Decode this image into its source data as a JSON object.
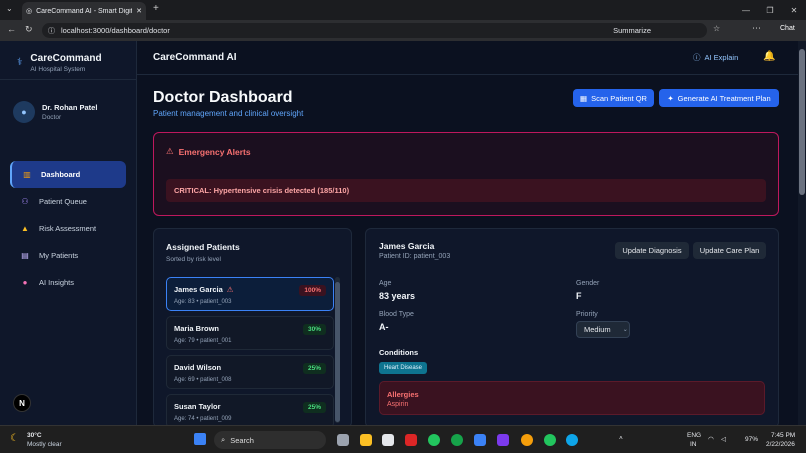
{
  "browser": {
    "tab_title": "CareCommand AI - Smart Digital H",
    "url": "localhost:3000/dashboard/doctor",
    "summarize_label": "Summarize",
    "chat_label": "Chat"
  },
  "sidebar": {
    "brand_title": "CareCommand",
    "brand_subtitle": "AI Hospital System",
    "user_name": "Dr. Rohan Patel",
    "user_role": "Doctor",
    "items": [
      {
        "label": "Dashboard",
        "icon": "chart-icon"
      },
      {
        "label": "Patient Queue",
        "icon": "users-icon"
      },
      {
        "label": "Risk Assessment",
        "icon": "warning-icon"
      },
      {
        "label": "My Patients",
        "icon": "clipboard-icon"
      },
      {
        "label": "AI Insights",
        "icon": "brain-icon"
      }
    ],
    "badge": "N"
  },
  "header": {
    "app_title": "CareCommand AI",
    "ai_explain": "AI Explain"
  },
  "page": {
    "title": "Doctor Dashboard",
    "subtitle": "Patient management and clinical oversight",
    "scan_button": "Scan Patient QR",
    "generate_button": "Generate AI Treatment Plan"
  },
  "alerts": {
    "title": "Emergency Alerts",
    "items": [
      "CRITICAL: Hypertensive crisis detected (185/110)"
    ]
  },
  "assigned": {
    "title": "Assigned Patients",
    "subtitle": "Sorted by risk level",
    "patients": [
      {
        "name": "James Garcia",
        "meta": "Age: 83 • patient_003",
        "risk": "100%"
      },
      {
        "name": "Maria Brown",
        "meta": "Age: 79 • patient_001",
        "risk": "30%"
      },
      {
        "name": "David Wilson",
        "meta": "Age: 69 • patient_008",
        "risk": "25%"
      },
      {
        "name": "Susan Taylor",
        "meta": "Age: 74 • patient_009",
        "risk": "25%"
      }
    ]
  },
  "detail": {
    "name": "James Garcia",
    "patient_id": "Patient ID: patient_003",
    "update_diagnosis": "Update Diagnosis",
    "update_care_plan": "Update Care Plan",
    "age_label": "Age",
    "age_value": "83 years",
    "gender_label": "Gender",
    "gender_value": "F",
    "blood_label": "Blood Type",
    "blood_value": "A-",
    "priority_label": "Priority",
    "priority_value": "Medium",
    "conditions_label": "Conditions",
    "condition_tag": "Heart Disease",
    "allergies_label": "Allergies",
    "allergies_value": "Aspirin"
  },
  "taskbar": {
    "weather_temp": "30°C",
    "weather_desc": "Mostly clear",
    "search": "Search",
    "lang1": "ENG",
    "lang2": "IN",
    "battery": "97%",
    "time": "7:45 PM",
    "date": "2/22/2026"
  },
  "colors": {
    "accent": "#2563eb",
    "danger": "#f87171",
    "success": "#4ade80",
    "bg": "#0b1120"
  }
}
